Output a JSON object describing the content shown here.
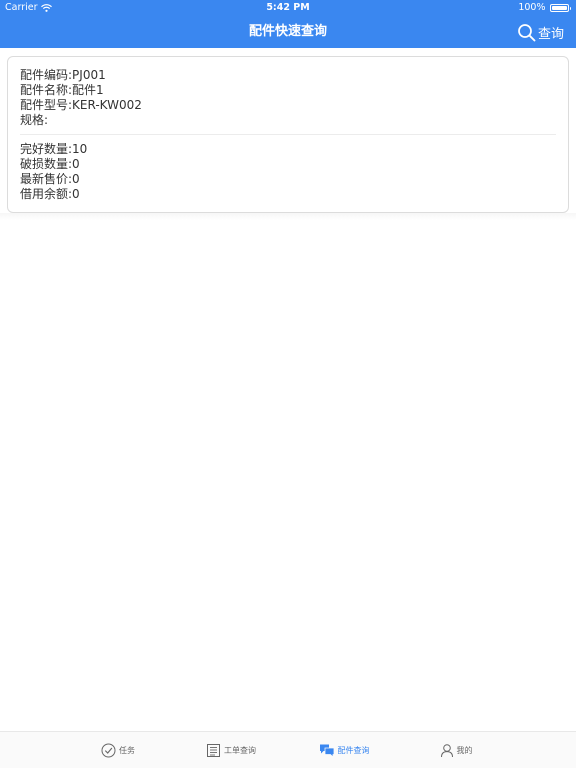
{
  "status_bar": {
    "carrier": "Carrier",
    "time": "5:42 PM",
    "battery": "100%"
  },
  "navbar": {
    "title": "配件快速查询",
    "search_label": "查询",
    "search_icon": "search-icon"
  },
  "card": {
    "group1": [
      "配件编码:PJ001",
      "配件名称:配件1",
      "配件型号:KER-KW002",
      "规格:"
    ],
    "group2": [
      "完好数量:10",
      "破损数量:0",
      "最新售价:0",
      "借用余额:0"
    ]
  },
  "tabbar": {
    "tabs": [
      {
        "label": "任务",
        "icon": "check-circle-icon"
      },
      {
        "label": "工单查询",
        "icon": "document-icon"
      },
      {
        "label": "配件查询",
        "icon": "chat-bubbles-icon",
        "active": true
      },
      {
        "label": "我的",
        "icon": "user-icon"
      }
    ]
  },
  "colors": {
    "accent": "#3a87f0",
    "text": "#333333",
    "border": "#dcdcdc"
  }
}
